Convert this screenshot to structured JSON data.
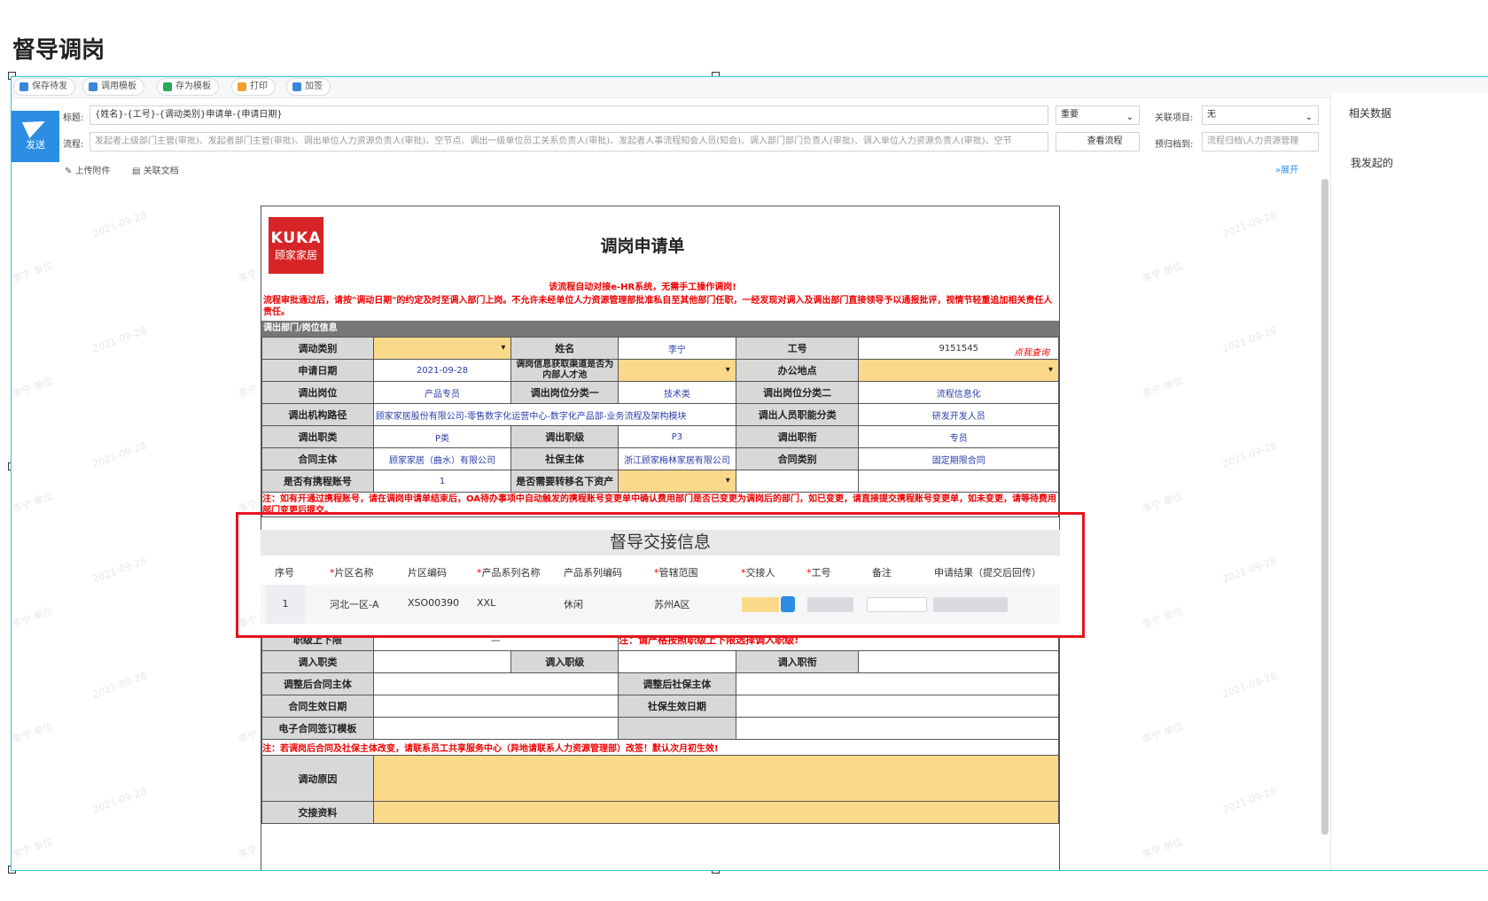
{
  "doc_title": "督导调岗",
  "toolbar": {
    "save_draft": "保存待发",
    "use_template": "调用模板",
    "save_template": "存为模板",
    "print": "打印",
    "add_sign": "加签"
  },
  "header": {
    "send_label": "发送",
    "title_label": "标题:",
    "title_value": "{姓名}-{工号}-{调动类别}申请单-{申请日期}",
    "importance": "重要",
    "related_label": "关联项目:",
    "related_value": "无",
    "flow_label": "流程:",
    "flow_value": "发起者上级部门主管(审批)、发起者部门主管(审批)、调出单位人力资源负责人(审批)、空节点、调出一级单位员工关系负责人(审批)、发起者人事流程知会人员(知会)、调入部门部门负责人(审批)、调入单位人力资源负责人(审批)、空节",
    "view_flow": "查看流程",
    "archive_label": "预归档到:",
    "archive_value": "流程归档\\人力资源管理",
    "upload": "上传附件",
    "related_doc": "关联文档",
    "expand": "展开"
  },
  "side_panel": {
    "tab": "相关数据",
    "item": "我发起的"
  },
  "watermark": "2021-09-28",
  "watermark2": "李宁  单位",
  "form": {
    "logo_en": "KUKA",
    "logo_cn": "顾家家居",
    "title": "调岗申请单",
    "notice1": "该流程自动对接e-HR系统，无需手工操作调岗!",
    "notice2": "流程审批通过后，请按\"调动日期\"的约定及时至调入部门上岗。不允许未经单位人力资源管理部批准私自至其他部门任职，一经发现对调入及调出部门直接领导予以通报批评，视情节轻重追加相关责任人责任。",
    "section": "调出部门/岗位信息",
    "rows": [
      [
        "调动类别",
        "",
        "姓名",
        "李宁",
        "工号",
        "9151545"
      ],
      [
        "申请日期",
        "2021-09-28",
        "调岗信息获取渠道是否为内部人才池",
        "",
        "办公地点",
        ""
      ],
      [
        "调出岗位",
        "产品专员",
        "调出岗位分类一",
        "技术类",
        "调出岗位分类二",
        "流程信息化"
      ],
      [
        "调出机构路径",
        "顾家家居股份有限公司-零售数字化运营中心-数字化产品部-业务流程及架构模块",
        "",
        "",
        "调出人员职能分类",
        "研发开发人员"
      ],
      [
        "调出职类",
        "P类",
        "调出职级",
        "P3",
        "调出职衔",
        "专员"
      ],
      [
        "合同主体",
        "顾家家居（曲水）有限公司",
        "社保主体",
        "浙江顾家梅林家居有限公司",
        "合同类别",
        "固定期限合同"
      ],
      [
        "是否有携程账号",
        "1",
        "是否需要转移名下资产",
        "",
        "",
        ""
      ]
    ],
    "click_query": "点我查询",
    "note_ctrip": "注：如有开通过携程账号，请在调岗申请单结束后，OA待办事项中自动触发的携程账号变更单中确认费用部门是否已变更为调岗后的部门，如已变更，请直接提交携程账号变更单，如未变更，请等待费用部门变更后提交。",
    "lower_rows": [
      [
        "职级上下限",
        "—",
        "注：请严格按照职级上下限选择调入职级!"
      ],
      [
        "调入职类",
        "调入职级",
        "调入职衔"
      ],
      [
        "调整后合同主体",
        "调整后社保主体"
      ],
      [
        "合同生效日期",
        "社保生效日期"
      ],
      [
        "电子合同签订模板"
      ]
    ],
    "note_contract": "注：若调岗后合同及社保主体改变，请联系员工共享服务中心（异地请联系人力资源管理部）改签！默认次月初生效!",
    "reason_label": "调动原因",
    "next_label": "交接资料"
  },
  "handover": {
    "title": "督导交接信息",
    "columns": [
      "序号",
      "片区名称",
      "片区编码",
      "产品系列名称",
      "产品系列编码",
      "管辖范围",
      "交接人",
      "工号",
      "备注",
      "申请结果（提交后回传）"
    ],
    "rows": [
      {
        "seq": "1",
        "area_name": "河北一区-A",
        "area_code": "XSO00390",
        "series_name": "XXL",
        "series_code": "休闲",
        "scope": "苏州A区"
      }
    ]
  }
}
